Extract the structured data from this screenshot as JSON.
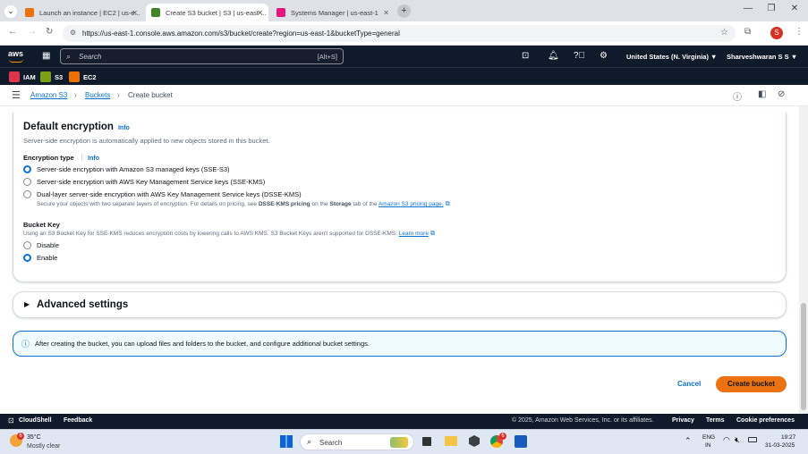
{
  "browser": {
    "tabs": [
      {
        "title": "Launch an instance | EC2 | us-e...",
        "active": false,
        "color": "#e8710a"
      },
      {
        "title": "Create S3 bucket | S3 | us-east-...",
        "active": true,
        "color": "#3f8624"
      },
      {
        "title": "Systems Manager | us-east-1",
        "active": false,
        "color": "#e7157b"
      }
    ],
    "url": "https://us-east-1.console.aws.amazon.com/s3/bucket/create?region=us-east-1&bucketType=general",
    "profile_initial": "S"
  },
  "aws_nav": {
    "logo": "aws",
    "search_placeholder": "Search",
    "search_shortcut": "[Alt+S]",
    "region": "United States (N. Virginia) ▼",
    "user": "Sharveshwaran S S ▼"
  },
  "favorites": [
    {
      "label": "IAM",
      "color": "#dd344c"
    },
    {
      "label": "S3",
      "color": "#7aa116"
    },
    {
      "label": "EC2",
      "color": "#ed7100"
    }
  ],
  "breadcrumb": {
    "items": [
      "Amazon S3",
      "Buckets"
    ],
    "current": "Create bucket"
  },
  "encryption": {
    "title": "Default encryption",
    "info": "Info",
    "description": "Server-side encryption is automatically applied to new objects stored in this bucket.",
    "type_label": "Encryption type",
    "type_info": "Info",
    "options": [
      {
        "label": "Server-side encryption with Amazon S3 managed keys (SSE-S3)",
        "selected": true
      },
      {
        "label": "Server-side encryption with AWS Key Management Service keys (SSE-KMS)",
        "selected": false
      },
      {
        "label": "Dual-layer server-side encryption with AWS Key Management Service keys (DSSE-KMS)",
        "selected": false
      }
    ],
    "dsse_note_1": "Secure your objects with two separate layers of encryption. For details on pricing, see",
    "dsse_note_bold_1": "DSSE-KMS pricing",
    "dsse_note_2": "on the",
    "dsse_note_bold_2": "Storage",
    "dsse_note_3": "tab of the",
    "dsse_note_link": "Amazon S3 pricing page.",
    "bucket_key_label": "Bucket Key",
    "bucket_key_desc": "Using an S3 Bucket Key for SSE-KMS reduces encryption costs by lowering calls to AWS KMS. S3 Bucket Keys aren't supported for DSSE-KMS.",
    "learn_more": "Learn more",
    "bucket_key_options": [
      {
        "label": "Disable",
        "selected": false
      },
      {
        "label": "Enable",
        "selected": true
      }
    ]
  },
  "advanced": {
    "title": "Advanced settings"
  },
  "alert": {
    "text": "After creating the bucket, you can upload files and folders to the bucket, and configure additional bucket settings."
  },
  "actions": {
    "cancel": "Cancel",
    "create": "Create bucket"
  },
  "footer": {
    "cloudshell": "CloudShell",
    "feedback": "Feedback",
    "copyright": "© 2025, Amazon Web Services, Inc. or its affiliates.",
    "privacy": "Privacy",
    "terms": "Terms",
    "cookies": "Cookie preferences"
  },
  "taskbar": {
    "weather_temp": "35°C",
    "weather_desc": "Mostly clear",
    "weather_badge": "6",
    "search": "Search",
    "lang_1": "ENG",
    "lang_2": "IN",
    "time": "19:27",
    "date": "31-03-2025",
    "chrome_badge": "6"
  }
}
